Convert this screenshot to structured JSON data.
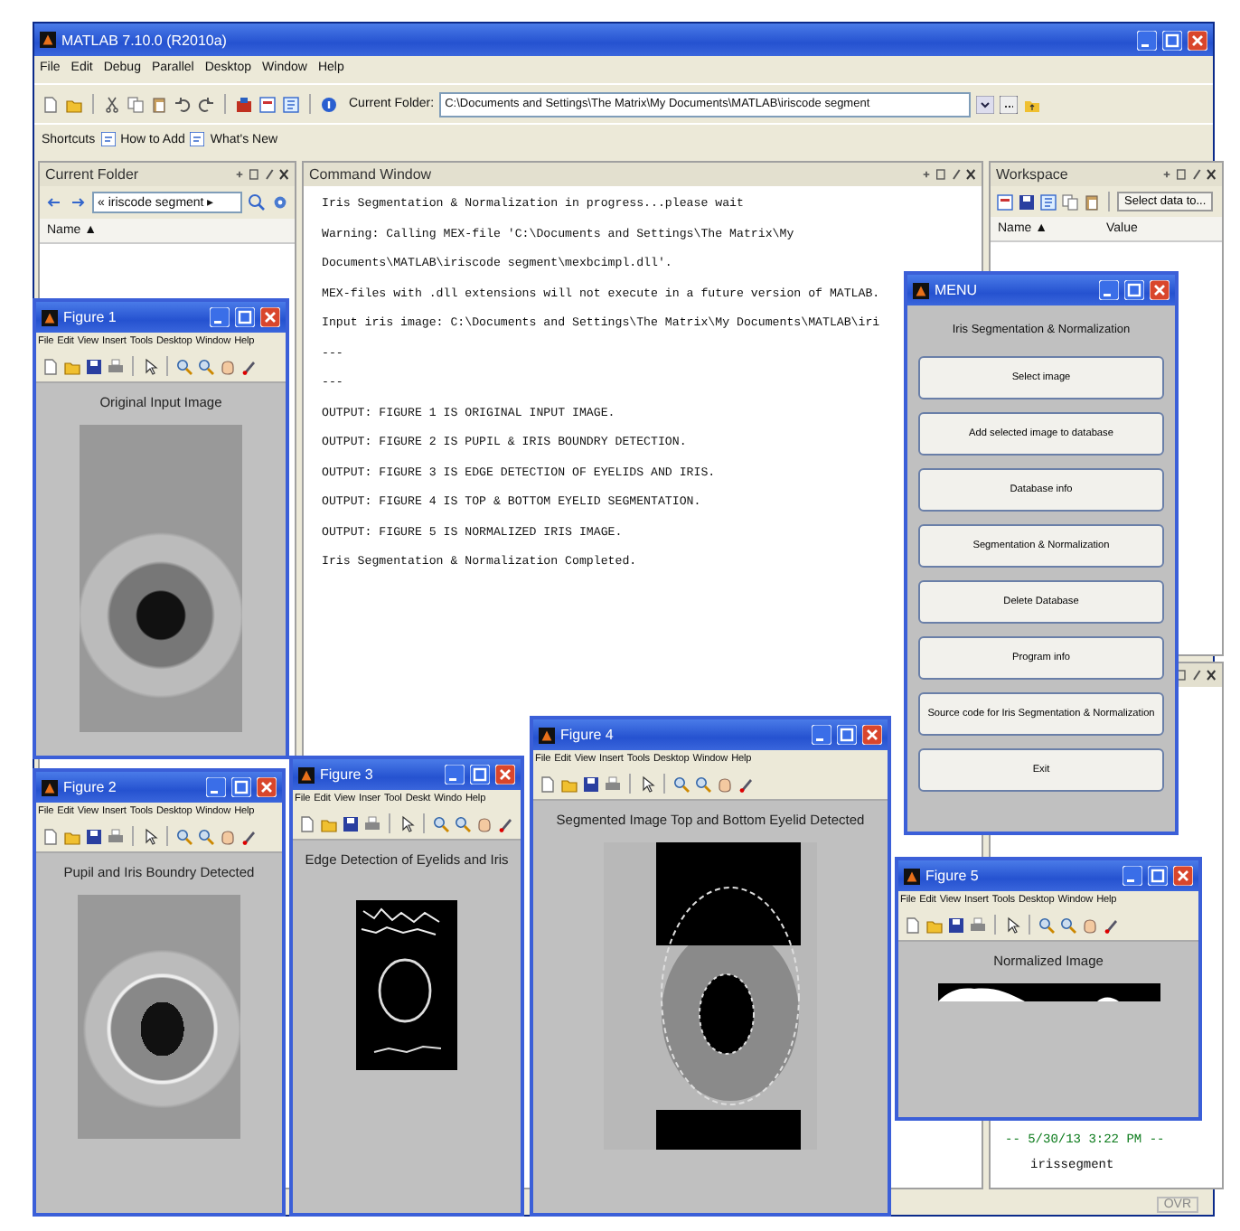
{
  "window": {
    "title": "MATLAB  7.10.0 (R2010a)"
  },
  "menu_bar": [
    "File",
    "Edit",
    "Debug",
    "Parallel",
    "Desktop",
    "Window",
    "Help"
  ],
  "toolbar": {
    "current_folder_label": "Current Folder:",
    "current_folder_path": "C:\\Documents and Settings\\The Matrix\\My Documents\\MATLAB\\iriscode segment"
  },
  "shortcuts_bar": [
    "Shortcuts",
    "How to Add",
    "What's New"
  ],
  "current_folder_panel": {
    "title": "Current Folder",
    "breadcrumb": "« iriscode segment ▸",
    "column": "Name ▲"
  },
  "command_window": {
    "title": "Command Window",
    "lines": [
      "Iris Segmentation & Normalization in progress...please wait",
      "Warning: Calling MEX-file 'C:\\Documents and Settings\\The Matrix\\My",
      "Documents\\MATLAB\\iriscode segment\\mexbcimpl.dll'.",
      "MEX-files with .dll extensions will not execute in a future version of MATLAB.",
      "Input iris image: C:\\Documents and Settings\\The Matrix\\My Documents\\MATLAB\\iri",
      "---",
      "---",
      "OUTPUT: FIGURE 1 IS ORIGINAL INPUT IMAGE.",
      "OUTPUT: FIGURE 2 IS PUPIL & IRIS BOUNDRY DETECTION.",
      "OUTPUT: FIGURE 3 IS EDGE DETECTION OF EYELIDS AND IRIS.",
      "OUTPUT: FIGURE 4 IS TOP & BOTTOM EYELID SEGMENTATION.",
      "OUTPUT: FIGURE 5 IS NORMALIZED IRIS IMAGE.",
      "Iris Segmentation & Normalization Completed."
    ]
  },
  "workspace_panel": {
    "title": "Workspace",
    "select_data": "Select data to...",
    "columns": [
      "Name ▲",
      "Value"
    ]
  },
  "command_history": {
    "entries": [
      {
        "kind": "session",
        "text": "-- 5/30/13  3:22 PM --"
      },
      {
        "kind": "command",
        "text": "irissegment"
      }
    ]
  },
  "status_bar": {
    "mode": "OVR"
  },
  "figures": [
    {
      "title": "Figure 1",
      "menus": [
        "File",
        "Edit",
        "View",
        "Insert",
        "Tools",
        "Desktop",
        "Window",
        "Help"
      ],
      "caption": "Original Input Image",
      "image": {
        "kind": "photo"
      }
    },
    {
      "title": "Figure 2",
      "menus": [
        "File",
        "Edit",
        "View",
        "Insert",
        "Tools",
        "Desktop",
        "Window",
        "Help"
      ],
      "caption": "Pupil and Iris Boundry Detected",
      "image": {
        "kind": "pupil"
      }
    },
    {
      "title": "Figure 3",
      "menus": [
        "File",
        "Edit",
        "View",
        "Inser",
        "Tool",
        "Deskt",
        "Windo",
        "Help"
      ],
      "caption": "Edge Detection of Eyelids and Iris",
      "image": {
        "kind": "edge"
      }
    },
    {
      "title": "Figure 4",
      "menus": [
        "File",
        "Edit",
        "View",
        "Insert",
        "Tools",
        "Desktop",
        "Window",
        "Help"
      ],
      "caption": "Segmented Image Top and Bottom Eyelid Detected",
      "image": {
        "kind": "segmented"
      }
    },
    {
      "title": "Figure 5",
      "menus": [
        "File",
        "Edit",
        "View",
        "Insert",
        "Tools",
        "Desktop",
        "Window",
        "Help"
      ],
      "caption": "Normalized Image",
      "image": {
        "kind": "normalized"
      }
    }
  ],
  "menu_dialog": {
    "title": "MENU",
    "heading": "Iris Segmentation & Normalization",
    "buttons": [
      "Select image",
      "Add selected image to database",
      "Database info",
      "Segmentation & Normalization",
      "Delete Database",
      "Program info",
      "Source code for Iris Segmentation & Normalization",
      "Exit"
    ]
  }
}
